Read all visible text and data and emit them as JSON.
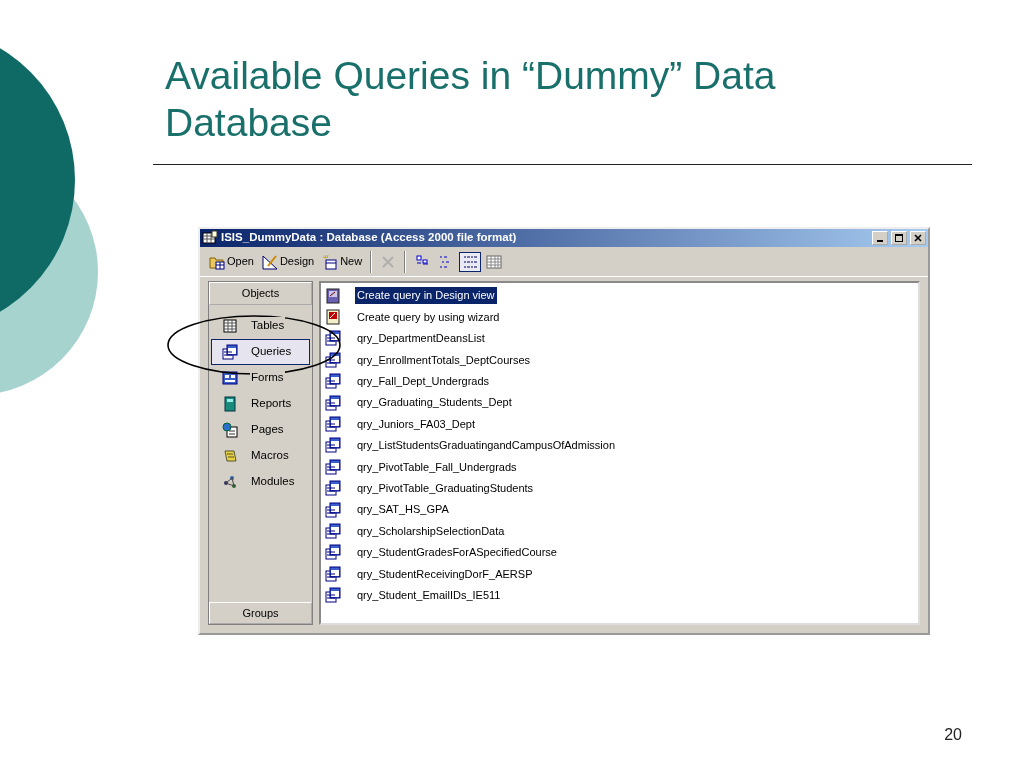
{
  "slide": {
    "title_lines": [
      "Available Queries in “Dummy” Data",
      "Database"
    ],
    "page_number": "20"
  },
  "window": {
    "title": "ISIS_DummyData : Database (Access 2000 file format)"
  },
  "toolbar": [
    {
      "kind": "open",
      "label": "Open",
      "disabled": false,
      "pressed": false
    },
    {
      "kind": "design",
      "label": "Design",
      "disabled": false,
      "pressed": false
    },
    {
      "kind": "new",
      "label": "New",
      "disabled": false,
      "pressed": false
    },
    {
      "kind": "delete",
      "disabled": true,
      "pressed": false
    },
    {
      "kind": "large-icons",
      "disabled": false,
      "pressed": false
    },
    {
      "kind": "small-icons",
      "disabled": false,
      "pressed": false
    },
    {
      "kind": "list",
      "disabled": false,
      "pressed": true
    },
    {
      "kind": "details",
      "disabled": false,
      "pressed": false
    }
  ],
  "sidebar": {
    "header": "Objects",
    "footer": "Groups",
    "items": [
      {
        "kind": "tables",
        "label": "Tables",
        "selected": false
      },
      {
        "kind": "queries",
        "label": "Queries",
        "selected": true
      },
      {
        "kind": "forms",
        "label": "Forms",
        "selected": false
      },
      {
        "kind": "reports",
        "label": "Reports",
        "selected": false
      },
      {
        "kind": "pages",
        "label": "Pages",
        "selected": false
      },
      {
        "kind": "macros",
        "label": "Macros",
        "selected": false
      },
      {
        "kind": "modules",
        "label": "Modules",
        "selected": false
      }
    ]
  },
  "objects": [
    {
      "kind": "design",
      "label": "Create query in Design view",
      "selected": true
    },
    {
      "kind": "wizard",
      "label": "Create query by using wizard",
      "selected": false
    },
    {
      "kind": "query",
      "label": "qry_DepartmentDeansList",
      "selected": false
    },
    {
      "kind": "query",
      "label": "qry_EnrollmentTotals_DeptCourses",
      "selected": false
    },
    {
      "kind": "query",
      "label": "qry_Fall_Dept_Undergrads",
      "selected": false
    },
    {
      "kind": "query",
      "label": "qry_Graduating_Students_Dept",
      "selected": false
    },
    {
      "kind": "query",
      "label": "qry_Juniors_FA03_Dept",
      "selected": false
    },
    {
      "kind": "query",
      "label": "qry_ListStudentsGraduatingandCampusOfAdmission",
      "selected": false
    },
    {
      "kind": "query",
      "label": "qry_PivotTable_Fall_Undergrads",
      "selected": false
    },
    {
      "kind": "query",
      "label": "qry_PivotTable_GraduatingStudents",
      "selected": false
    },
    {
      "kind": "query",
      "label": "qry_SAT_HS_GPA",
      "selected": false
    },
    {
      "kind": "query",
      "label": "qry_ScholarshipSelectionData",
      "selected": false
    },
    {
      "kind": "query",
      "label": "qry_StudentGradesForASpecifiedCourse",
      "selected": false
    },
    {
      "kind": "query",
      "label": "qry_StudentReceivingDorF_AERSP",
      "selected": false
    },
    {
      "kind": "query",
      "label": "qry_Student_EmailIDs_IE511",
      "selected": false
    }
  ]
}
